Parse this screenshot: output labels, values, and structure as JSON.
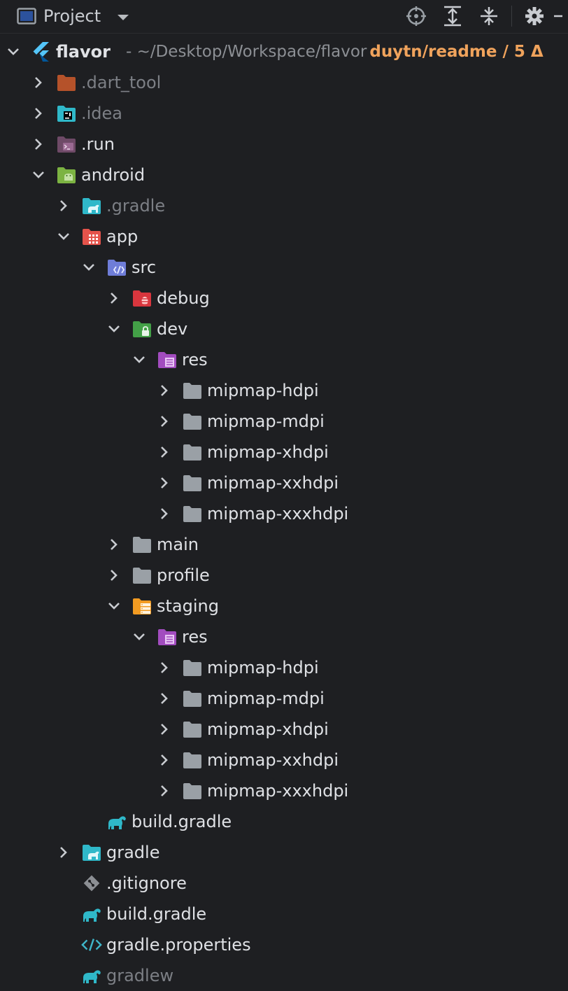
{
  "toolbar": {
    "title": "Project",
    "icons": [
      "project-view-icon",
      "dropdown-arrow-icon",
      "locate-icon",
      "expand-all-icon",
      "collapse-all-icon",
      "settings-gear-icon",
      "hide-icon"
    ]
  },
  "root": {
    "name": "flavor",
    "path": "- ~/Desktop/Workspace/flavor",
    "branch": "duytn/readme / 5 Δ"
  },
  "tree": [
    {
      "label": ".dart_tool",
      "dim": true,
      "icon": "folder-excluded-icon",
      "state": "collapsed"
    },
    {
      "label": ".idea",
      "dim": true,
      "icon": "folder-idea-icon",
      "state": "collapsed"
    },
    {
      "label": ".run",
      "icon": "folder-run-icon",
      "state": "collapsed"
    },
    {
      "label": "android",
      "icon": "folder-android-icon",
      "state": "expanded"
    },
    {
      "label": ".gradle",
      "dim": true,
      "icon": "folder-gradle-icon",
      "state": "collapsed"
    },
    {
      "label": "app",
      "icon": "folder-app-icon",
      "state": "expanded"
    },
    {
      "label": "src",
      "icon": "folder-src-icon",
      "state": "expanded"
    },
    {
      "label": "debug",
      "icon": "folder-debug-icon",
      "state": "collapsed"
    },
    {
      "label": "dev",
      "icon": "folder-dev-icon",
      "state": "expanded"
    },
    {
      "label": "res",
      "icon": "folder-res-icon",
      "state": "expanded"
    },
    {
      "label": "mipmap-hdpi",
      "icon": "folder-icon",
      "state": "collapsed"
    },
    {
      "label": "mipmap-mdpi",
      "icon": "folder-icon",
      "state": "collapsed"
    },
    {
      "label": "mipmap-xhdpi",
      "icon": "folder-icon",
      "state": "collapsed"
    },
    {
      "label": "mipmap-xxhdpi",
      "icon": "folder-icon",
      "state": "collapsed"
    },
    {
      "label": "mipmap-xxxhdpi",
      "icon": "folder-icon",
      "state": "collapsed"
    },
    {
      "label": "main",
      "icon": "folder-icon",
      "state": "collapsed"
    },
    {
      "label": "profile",
      "icon": "folder-icon",
      "state": "collapsed"
    },
    {
      "label": "staging",
      "icon": "folder-staging-icon",
      "state": "expanded"
    },
    {
      "label": "res",
      "icon": "folder-res-icon",
      "state": "expanded"
    },
    {
      "label": "mipmap-hdpi",
      "icon": "folder-icon",
      "state": "collapsed"
    },
    {
      "label": "mipmap-mdpi",
      "icon": "folder-icon",
      "state": "collapsed"
    },
    {
      "label": "mipmap-xhdpi",
      "icon": "folder-icon",
      "state": "collapsed"
    },
    {
      "label": "mipmap-xxhdpi",
      "icon": "folder-icon",
      "state": "collapsed"
    },
    {
      "label": "mipmap-xxxhdpi",
      "icon": "folder-icon",
      "state": "collapsed"
    },
    {
      "label": "build.gradle",
      "icon": "gradle-file-icon",
      "state": "leaf"
    },
    {
      "label": "gradle",
      "icon": "folder-gradle-icon",
      "state": "collapsed"
    },
    {
      "label": ".gitignore",
      "icon": "gitignore-file-icon",
      "state": "leaf"
    },
    {
      "label": "build.gradle",
      "icon": "gradle-file-icon",
      "state": "leaf"
    },
    {
      "label": "gradle.properties",
      "icon": "properties-file-icon",
      "state": "leaf"
    },
    {
      "label": "gradlew",
      "dim": true,
      "icon": "gradle-file-icon",
      "state": "leaf"
    }
  ],
  "colors": {
    "background": "#1e1f22",
    "text": "#dfe1e5",
    "dim_text": "#7c7f85",
    "branch": "#f0a35c",
    "folder": "#9aa0a6",
    "gradle": "#2fb8c9"
  }
}
